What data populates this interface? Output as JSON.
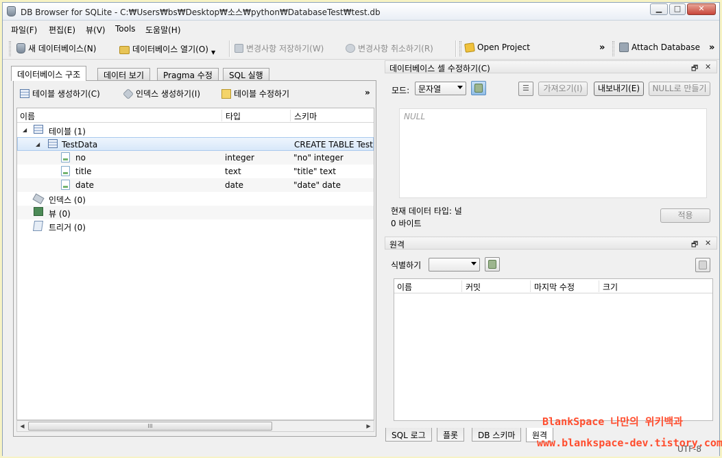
{
  "window": {
    "title": "DB Browser for SQLite - C:₩Users₩bs₩Desktop₩소스₩python₩DatabaseTest₩test.db",
    "min_label": "▁",
    "max_label": "□",
    "close_label": "✕"
  },
  "menu": [
    "파일(F)",
    "편집(E)",
    "뷰(V)",
    "Tools",
    "도움말(H)"
  ],
  "toolbar": {
    "new_db": "새 데이터베이스(N)",
    "open_db": "데이터베이스 열기(O)",
    "write_changes": "변경사항 저장하기(W)",
    "revert_changes": "변경사항 취소하기(R)",
    "open_project": "Open Project",
    "attach_db": "Attach Database",
    "more": "»"
  },
  "left_tabs": [
    "데이터베이스 구조",
    "데이터 보기",
    "Pragma 수정",
    "SQL 실행"
  ],
  "structure_toolbar": {
    "create_table": "테이블 생성하기(C)",
    "create_index": "인덱스 생성하기(I)",
    "modify_table": "테이블 수정하기",
    "more": "»"
  },
  "tree": {
    "columns": [
      "이름",
      "타입",
      "스키마"
    ],
    "rows": [
      {
        "name": "테이블 (1)",
        "type": "",
        "schema": ""
      },
      {
        "name": "TestData",
        "type": "",
        "schema": "CREATE TABLE TestDat"
      },
      {
        "name": "no",
        "type": "integer",
        "schema": "\"no\" integer"
      },
      {
        "name": "title",
        "type": "text",
        "schema": "\"title\" text"
      },
      {
        "name": "date",
        "type": "date",
        "schema": "\"date\" date"
      },
      {
        "name": "인덱스 (0)",
        "type": "",
        "schema": ""
      },
      {
        "name": "뷰 (0)",
        "type": "",
        "schema": ""
      },
      {
        "name": "트리거 (0)",
        "type": "",
        "schema": ""
      }
    ],
    "scroll_thumb_label": "III"
  },
  "edit_cell": {
    "title": "데이터베이스 셀 수정하기(C)",
    "mode_label": "모드:",
    "mode_value": "문자열",
    "import_label": "가져오기(I)",
    "export_label": "내보내기(E)",
    "set_null_label": "NULL로 만들기",
    "null_placeholder": "NULL",
    "type_info": "현재 데이터 타입: 널",
    "size_info": "0 바이트",
    "apply_label": "적용"
  },
  "remote": {
    "title": "원격",
    "identity_label": "식별하기",
    "columns": [
      "이름",
      "커밋",
      "마지막 수정",
      "크기"
    ]
  },
  "bottom_tabs": [
    "SQL 로그",
    "플롯",
    "DB 스키마",
    "원격"
  ],
  "status": {
    "encoding": "UTF-8"
  },
  "watermark": {
    "line1": "BlankSpace 나만의 위키백과",
    "line2": "www.blankspace-dev.tistory.com"
  },
  "dock_buttons": {
    "float": "🗗",
    "close": "✕"
  },
  "colors": {
    "watermark": "#ff4d2e",
    "selection": "#d8e8f9"
  }
}
